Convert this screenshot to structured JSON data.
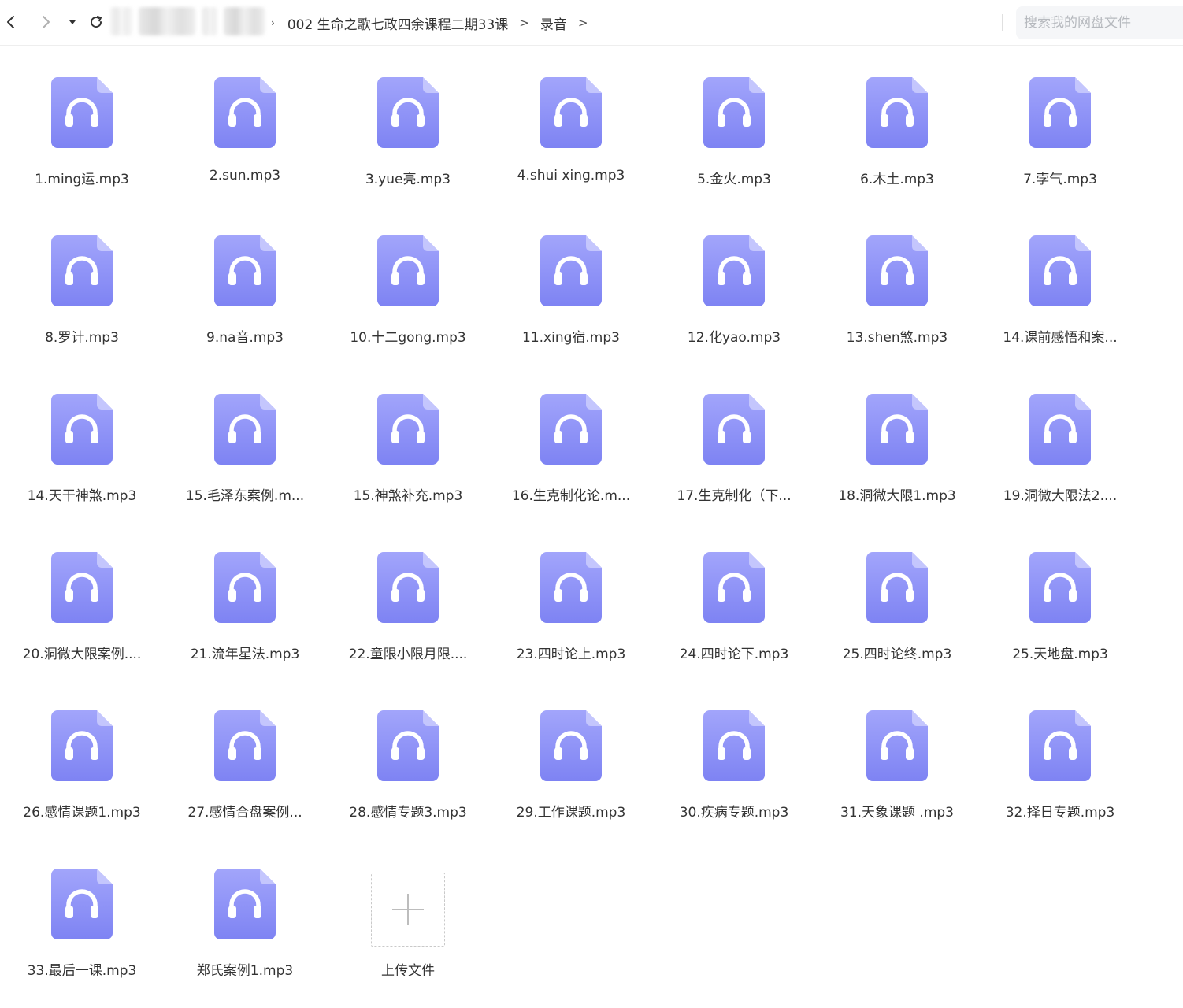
{
  "toolbar": {
    "breadcrumb": [
      {
        "label": "002 生命之歌七政四余课程二期33课"
      },
      {
        "label": "录音"
      }
    ],
    "search_placeholder": "搜索我的网盘文件"
  },
  "colors": {
    "file_icon_top": "#a2a5fb",
    "file_icon_bottom": "#7e83f3",
    "file_icon_fold": "#c4c6fd"
  },
  "files": [
    {
      "name": "1.ming运.mp3"
    },
    {
      "name": "2.sun.mp3"
    },
    {
      "name": "3.yue亮.mp3"
    },
    {
      "name": "4.shui xing.mp3"
    },
    {
      "name": "5.金火.mp3"
    },
    {
      "name": "6.木土.mp3"
    },
    {
      "name": "7.孛气.mp3"
    },
    {
      "name": "8.罗计.mp3"
    },
    {
      "name": "9.na音.mp3"
    },
    {
      "name": "10.十二gong.mp3"
    },
    {
      "name": "11.xing宿.mp3"
    },
    {
      "name": "12.化yao.mp3"
    },
    {
      "name": "13.shen煞.mp3"
    },
    {
      "name": "14.课前感悟和案..."
    },
    {
      "name": "14.天干神煞.mp3"
    },
    {
      "name": "15.毛泽东案例.m..."
    },
    {
      "name": "15.神煞补充.mp3"
    },
    {
      "name": "16.生克制化论.m..."
    },
    {
      "name": "17.生克制化（下..."
    },
    {
      "name": "18.洞微大限1.mp3"
    },
    {
      "name": "19.洞微大限法2...."
    },
    {
      "name": "20.洞微大限案例...."
    },
    {
      "name": "21.流年星法.mp3"
    },
    {
      "name": "22.童限小限月限...."
    },
    {
      "name": "23.四时论上.mp3"
    },
    {
      "name": "24.四时论下.mp3"
    },
    {
      "name": "25.四时论终.mp3"
    },
    {
      "name": "25.天地盘.mp3"
    },
    {
      "name": "26.感情课题1.mp3"
    },
    {
      "name": "27.感情合盘案例..."
    },
    {
      "name": "28.感情专题3.mp3"
    },
    {
      "name": "29.工作课题.mp3"
    },
    {
      "name": "30.疾病专题.mp3"
    },
    {
      "name": "31.天象课题 .mp3"
    },
    {
      "name": "32.择日专题.mp3"
    },
    {
      "name": "33.最后一课.mp3"
    },
    {
      "name": "郑氏案例1.mp3"
    }
  ],
  "upload": {
    "label": "上传文件"
  }
}
